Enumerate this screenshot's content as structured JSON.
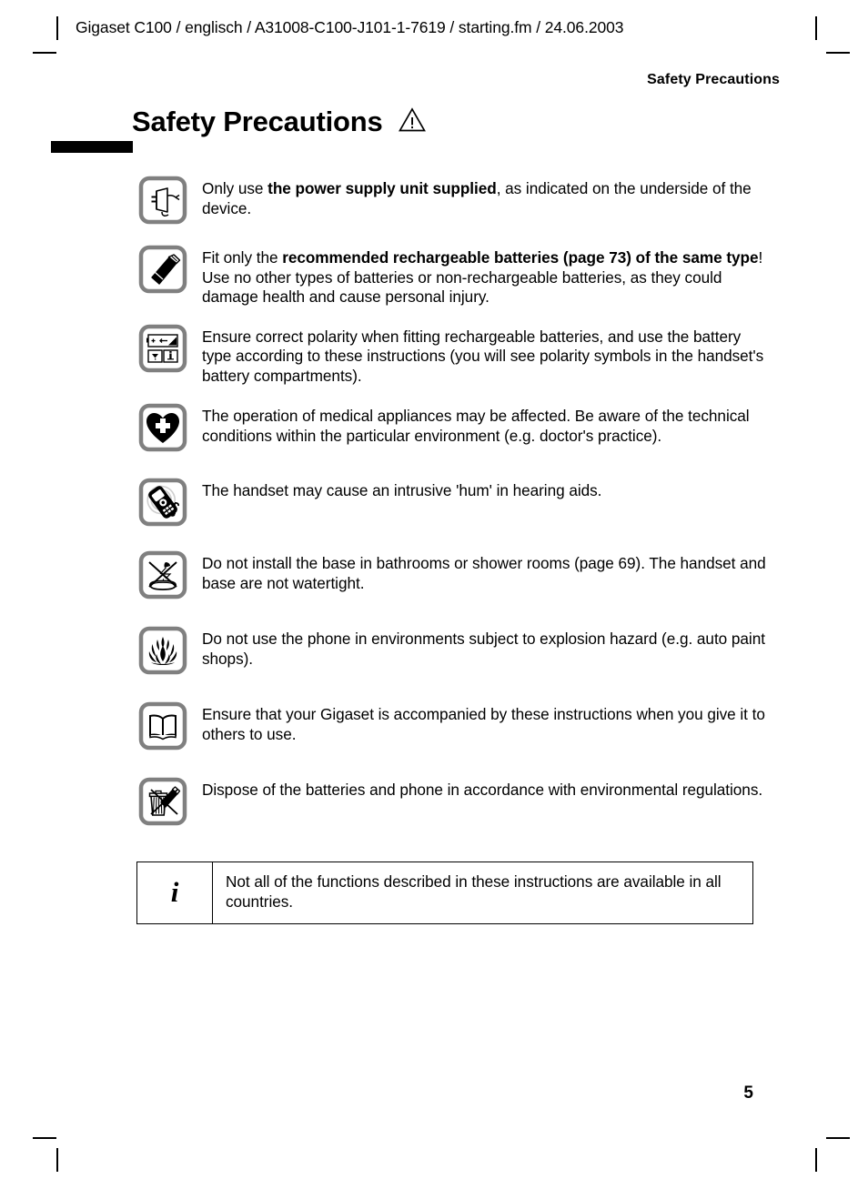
{
  "document": {
    "header_line": "Gigaset C100 / englisch / A31008-C100-J101-1-7619 / starting.fm / 24.06.2003",
    "running_head": "Safety Precautions",
    "chapter_title": "Safety Precautions",
    "chapter_title_icon": "warning-triangle-icon",
    "page_number": "5"
  },
  "notices": [
    {
      "icon": "power-supply-unit-icon",
      "text_parts": [
        {
          "text": "Only use ",
          "bold": false
        },
        {
          "text": "the power supply unit supplied",
          "bold": true
        },
        {
          "text": ", as indicated on the underside of the device.",
          "bold": false
        }
      ]
    },
    {
      "icon": "rechargeable-battery-icon",
      "text_parts": [
        {
          "text": "Fit only the ",
          "bold": false
        },
        {
          "text": "recommended rechargeable batteries (page 73) of the same type",
          "bold": true
        },
        {
          "text": "! Use no other types of batteries or non-rechargeable batteries, as they could damage health and cause personal injury.",
          "bold": false
        }
      ]
    },
    {
      "icon": "battery-polarity-icon",
      "text_parts": [
        {
          "text": "Ensure correct polarity when fitting rechargeable batteries, and use the battery type according to these instructions (you will see polarity symbols in the handset's  battery compartments).",
          "bold": false
        }
      ]
    },
    {
      "icon": "medical-heart-icon",
      "text_parts": [
        {
          "text": "The operation of medical appliances may be affected. Be aware of the technical conditions within the particular environment (e.g. doctor's practice).",
          "bold": false
        }
      ]
    },
    {
      "icon": "hearing-aid-interference-icon",
      "text_parts": [
        {
          "text": "The handset may cause an intrusive 'hum' in hearing aids.",
          "bold": false
        }
      ]
    },
    {
      "icon": "no-bathroom-shower-icon",
      "text_parts": [
        {
          "text": "Do not install the base in bathrooms or shower rooms (page 69). The handset and base are not watertight.",
          "bold": false
        }
      ]
    },
    {
      "icon": "explosion-hazard-flame-icon",
      "text_parts": [
        {
          "text": "Do not use the phone in environments subject to explosion hazard (e.g. auto paint shops).",
          "bold": false
        }
      ]
    },
    {
      "icon": "open-book-manual-icon",
      "text_parts": [
        {
          "text": "Ensure that your Gigaset is accompanied by these instructions when you give it to others to use.",
          "bold": false
        }
      ]
    },
    {
      "icon": "no-waste-bin-disposal-icon",
      "text_parts": [
        {
          "text": "Dispose of the batteries and phone in accordance with environmental regulations.",
          "bold": false
        }
      ]
    }
  ],
  "info_box": {
    "icon": "info-i-icon",
    "icon_glyph": "i",
    "text": "Not all of the functions described in these instructions are available in all countries."
  },
  "colors": {
    "text": "#000000",
    "icon_frame": "#808080",
    "page_background": "#ffffff"
  }
}
